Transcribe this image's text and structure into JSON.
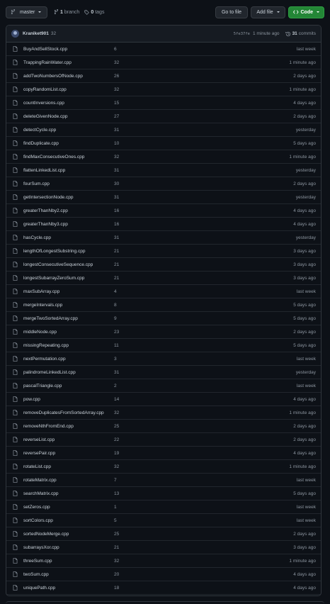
{
  "toolbar": {
    "branch_label": "master",
    "branch_count": "1",
    "branch_word": "branch",
    "tag_count": "0",
    "tag_word": "tags",
    "goto_label": "Go to file",
    "add_file_label": "Add file",
    "code_label": "Code"
  },
  "commit": {
    "author": "Kraniket901",
    "message": "32",
    "sha": "5fe37fe",
    "time": "1 minute ago",
    "count": "31",
    "count_word": "commits"
  },
  "files": [
    {
      "name": "BuyAndSellStock.cpp",
      "message": "6",
      "age": "last week"
    },
    {
      "name": "TrappingRainWater.cpp",
      "message": "32",
      "age": "1 minute ago"
    },
    {
      "name": "addTwoNumbersOfNode.cpp",
      "message": "26",
      "age": "2 days ago"
    },
    {
      "name": "copyRandomList.cpp",
      "message": "32",
      "age": "1 minute ago"
    },
    {
      "name": "countInversions.cpp",
      "message": "15",
      "age": "4 days ago"
    },
    {
      "name": "deleteGivenNode.cpp",
      "message": "27",
      "age": "2 days ago"
    },
    {
      "name": "detectCycle.cpp",
      "message": "31",
      "age": "yesterday"
    },
    {
      "name": "findDuplicate.cpp",
      "message": "10",
      "age": "5 days ago"
    },
    {
      "name": "findMaxConsecutiveOnes.cpp",
      "message": "32",
      "age": "1 minute ago"
    },
    {
      "name": "flattenLinkedList.cpp",
      "message": "31",
      "age": "yesterday"
    },
    {
      "name": "fourSum.cpp",
      "message": "30",
      "age": "2 days ago"
    },
    {
      "name": "getIntersectionNode.cpp",
      "message": "31",
      "age": "yesterday"
    },
    {
      "name": "greaterThanNby2.cpp",
      "message": "16",
      "age": "4 days ago"
    },
    {
      "name": "greaterThanNby3.cpp",
      "message": "16",
      "age": "4 days ago"
    },
    {
      "name": "hasCycle.cpp",
      "message": "31",
      "age": "yesterday"
    },
    {
      "name": "lengthOfLongestSubstring.cpp",
      "message": "21",
      "age": "3 days ago"
    },
    {
      "name": "longestConsecutiveSequence.cpp",
      "message": "21",
      "age": "3 days ago"
    },
    {
      "name": "longestSubarrayZeroSum.cpp",
      "message": "21",
      "age": "3 days ago"
    },
    {
      "name": "maxSubArray.cpp",
      "message": "4",
      "age": "last week"
    },
    {
      "name": "mergeIntervals.cpp",
      "message": "8",
      "age": "5 days ago"
    },
    {
      "name": "mergeTwoSortedArray.cpp",
      "message": "9",
      "age": "5 days ago"
    },
    {
      "name": "middleNode.cpp",
      "message": "23",
      "age": "2 days ago"
    },
    {
      "name": "missingRepeating.cpp",
      "message": "11",
      "age": "5 days ago"
    },
    {
      "name": "nextPermutation.cpp",
      "message": "3",
      "age": "last week"
    },
    {
      "name": "palindromeLinkedList.cpp",
      "message": "31",
      "age": "yesterday"
    },
    {
      "name": "pascalTriangle.cpp",
      "message": "2",
      "age": "last week"
    },
    {
      "name": "pow.cpp",
      "message": "14",
      "age": "4 days ago"
    },
    {
      "name": "removeDuplicatesFromSortedArray.cpp",
      "message": "32",
      "age": "1 minute ago"
    },
    {
      "name": "removeNthFromEnd.cpp",
      "message": "25",
      "age": "2 days ago"
    },
    {
      "name": "reverseList.cpp",
      "message": "22",
      "age": "2 days ago"
    },
    {
      "name": "reversePair.cpp",
      "message": "19",
      "age": "4 days ago"
    },
    {
      "name": "rotateList.cpp",
      "message": "32",
      "age": "1 minute ago"
    },
    {
      "name": "rotateMatrix.cpp",
      "message": "7",
      "age": "last week"
    },
    {
      "name": "searchMatrix.cpp",
      "message": "13",
      "age": "5 days ago"
    },
    {
      "name": "setZeros.cpp",
      "message": "1",
      "age": "last week"
    },
    {
      "name": "sortColors.cpp",
      "message": "5",
      "age": "last week"
    },
    {
      "name": "sortedNodeMerge.cpp",
      "message": "25",
      "age": "2 days ago"
    },
    {
      "name": "subarraysXor.cpp",
      "message": "21",
      "age": "3 days ago"
    },
    {
      "name": "threeSum.cpp",
      "message": "32",
      "age": "1 minute ago"
    },
    {
      "name": "twoSum.cpp",
      "message": "20",
      "age": "4 days ago"
    },
    {
      "name": "uniquePath.cpp",
      "message": "18",
      "age": "4 days ago"
    }
  ]
}
